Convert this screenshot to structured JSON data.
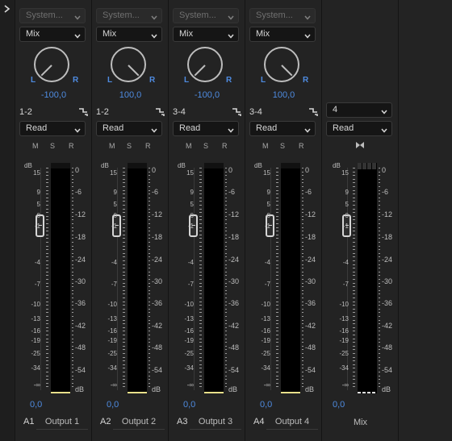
{
  "panel": {
    "expand_icon": "chevron-right-icon"
  },
  "strips": [
    {
      "id": "a1",
      "output_select": "System...",
      "mode": "Mix",
      "pan": "-100,0",
      "pan_angle": -45,
      "route": "1-2",
      "automation": "Read",
      "volume": "0,0",
      "track": "A1",
      "name": "Output 1"
    },
    {
      "id": "a2",
      "output_select": "System...",
      "mode": "Mix",
      "pan": "100,0",
      "pan_angle": 45,
      "route": "1-2",
      "automation": "Read",
      "volume": "0,0",
      "track": "A2",
      "name": "Output 2"
    },
    {
      "id": "a3",
      "output_select": "System...",
      "mode": "Mix",
      "pan": "-100,0",
      "pan_angle": -45,
      "route": "3-4",
      "automation": "Read",
      "volume": "0,0",
      "track": "A3",
      "name": "Output 3"
    },
    {
      "id": "a4",
      "output_select": "System...",
      "mode": "Mix",
      "pan": "100,0",
      "pan_angle": 45,
      "route": "3-4",
      "automation": "Read",
      "volume": "0,0",
      "track": "A4",
      "name": "Output 4"
    }
  ],
  "mix_strip": {
    "channels": "4",
    "automation": "Read",
    "volume": "0,0",
    "name": "Mix"
  },
  "labels": {
    "L": "L",
    "R": "R",
    "M": "M",
    "S": "S",
    "Rb": "R",
    "dB": "dB"
  },
  "scale_left": [
    "15",
    "9",
    "5",
    "0",
    "-1",
    "-4",
    "-7",
    "-10",
    "-13",
    "-16",
    "-19",
    "-25",
    "-34",
    "-∞"
  ],
  "scale_right": [
    "0",
    "-6",
    "-12",
    "-18",
    "-24",
    "-30",
    "-36",
    "-42",
    "-48",
    "-54",
    "dB"
  ],
  "colors": {
    "accent": "#4e8be0",
    "background": "#232323",
    "meter_base": "#e8e08a"
  }
}
